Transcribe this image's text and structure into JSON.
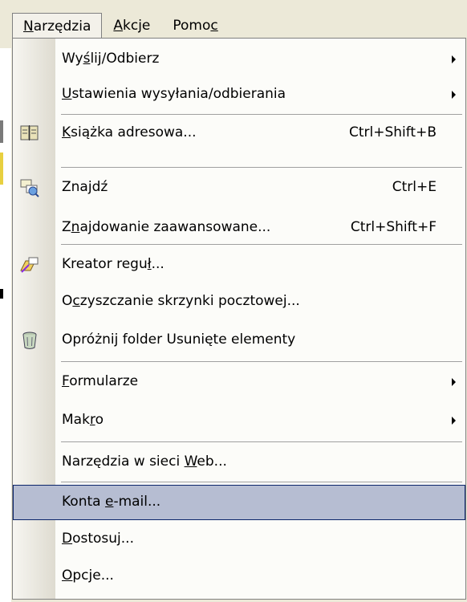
{
  "menubar": {
    "items": [
      {
        "pre": "",
        "ul": "N",
        "post": "arzędzia",
        "open": true
      },
      {
        "pre": "",
        "ul": "A",
        "post": "kcje",
        "open": false
      },
      {
        "pre": "Pomo",
        "ul": "c",
        "post": "",
        "open": false
      }
    ]
  },
  "menu": {
    "items": [
      {
        "pre": "Wy",
        "ul": "ś",
        "post": "lij/Odbierz",
        "shortcut": "",
        "submenu": true,
        "icon": "",
        "sep_before": false,
        "highlight": false
      },
      {
        "pre": "",
        "ul": "U",
        "post": "stawienia wysyłania/odbierania",
        "shortcut": "",
        "submenu": true,
        "icon": "",
        "sep_before": false,
        "highlight": false
      },
      {
        "pre": "",
        "ul": "K",
        "post": "siążka adresowa...",
        "shortcut": "Ctrl+Shift+B",
        "submenu": false,
        "icon": "address-book-icon",
        "sep_before": true,
        "highlight": false
      },
      {
        "pre": "Zna",
        "ul": "j",
        "post": "dź",
        "shortcut": "Ctrl+E",
        "submenu": false,
        "icon": "find-icon",
        "sep_before": true,
        "highlight": false
      },
      {
        "pre": "Z",
        "ul": "n",
        "post": "ajdowanie zaawansowane...",
        "shortcut": "Ctrl+Shift+F",
        "submenu": false,
        "icon": "",
        "sep_before": false,
        "highlight": false
      },
      {
        "pre": "Kreator regu",
        "ul": "ł",
        "post": "...",
        "shortcut": "",
        "submenu": false,
        "icon": "rules-wizard-icon",
        "sep_before": true,
        "highlight": false
      },
      {
        "pre": "O",
        "ul": "c",
        "post": "zyszczanie skrzynki pocztowej...",
        "shortcut": "",
        "submenu": false,
        "icon": "",
        "sep_before": false,
        "highlight": false
      },
      {
        "pre": "Opróżni",
        "ul": "j",
        "post": " folder Usunięte elementy",
        "shortcut": "",
        "submenu": false,
        "icon": "trash-icon",
        "sep_before": false,
        "highlight": false
      },
      {
        "pre": "",
        "ul": "F",
        "post": "ormularze",
        "shortcut": "",
        "submenu": true,
        "icon": "",
        "sep_before": true,
        "highlight": false
      },
      {
        "pre": "Mak",
        "ul": "r",
        "post": "o",
        "shortcut": "",
        "submenu": true,
        "icon": "",
        "sep_before": false,
        "highlight": false
      },
      {
        "pre": "Narzędzia w sieci ",
        "ul": "W",
        "post": "eb...",
        "shortcut": "",
        "submenu": false,
        "icon": "",
        "sep_before": true,
        "highlight": false
      },
      {
        "pre": "Konta ",
        "ul": "e",
        "post": "-mail...",
        "shortcut": "",
        "submenu": false,
        "icon": "",
        "sep_before": true,
        "highlight": true
      },
      {
        "pre": "",
        "ul": "D",
        "post": "ostosuj...",
        "shortcut": "",
        "submenu": false,
        "icon": "",
        "sep_before": false,
        "highlight": false
      },
      {
        "pre": "",
        "ul": "O",
        "post": "pcje...",
        "shortcut": "",
        "submenu": false,
        "icon": "",
        "sep_before": false,
        "highlight": false
      }
    ]
  }
}
